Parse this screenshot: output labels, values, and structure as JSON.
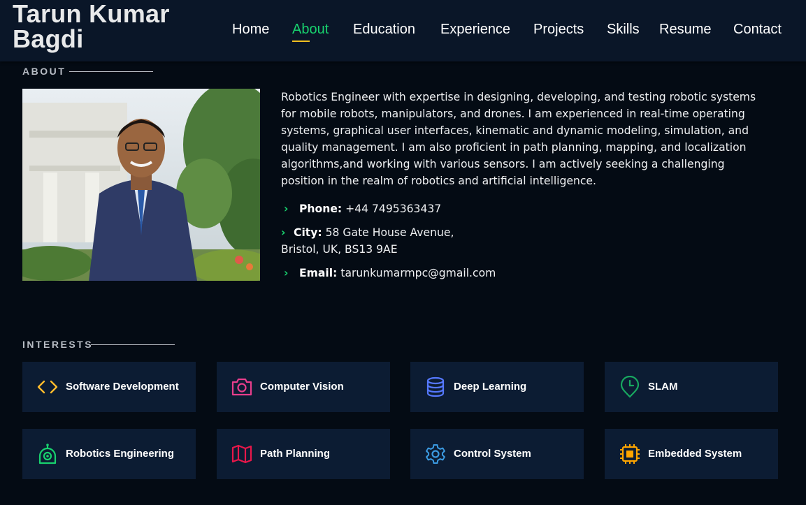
{
  "header": {
    "brand": "Tarun Kumar Bagdi",
    "nav": [
      "Home",
      "About",
      "Education",
      "Experience",
      "Projects",
      "Skills",
      "Resume",
      "Contact"
    ],
    "active": "About"
  },
  "about": {
    "section_title": "ABOUT",
    "paragraph": "Robotics Engineer with expertise in designing, developing, and testing robotic systems for mobile robots, manipulators, and drones. I am experienced in real-time operating systems, graphical user interfaces, kinematic and dynamic modeling, simulation, and quality management. I am also proficient in path planning, mapping, and localization algorithms,and working with various sensors. I am actively seeking a challenging position in the realm of robotics and artificial intelligence.",
    "phone_label": "Phone:",
    "phone_value": "+44 7495363437",
    "city_label": "City:",
    "city_value_1": "58 Gate House Avenue,",
    "city_value_2": "Bristol, UK, BS13 9AE",
    "email_label": "Email:",
    "email_value": "tarunkumarmpc@gmail.com"
  },
  "interests": {
    "section_title": "INTERESTS",
    "items": [
      {
        "label": "Software Development",
        "icon": "code-icon",
        "color": "#ffbb2c"
      },
      {
        "label": "Computer Vision",
        "icon": "camera-icon",
        "color": "#e83e8c"
      },
      {
        "label": "Deep Learning",
        "icon": "database-icon",
        "color": "#5578ff"
      },
      {
        "label": "SLAM",
        "icon": "clock-pin-icon",
        "color": "#11dbcf"
      },
      {
        "label": "Robotics Engineering",
        "icon": "robot-icon",
        "color": "#18d26e"
      },
      {
        "label": "Path Planning",
        "icon": "map-icon",
        "color": "#e80368"
      },
      {
        "label": "Control System",
        "icon": "gear-icon",
        "color": "#3b9ae1"
      },
      {
        "label": "Embedded System",
        "icon": "chip-icon",
        "color": "#ffa500"
      }
    ]
  },
  "colors": {
    "accent": "#18d26e",
    "background": "#040b14",
    "card": "#0c1c33"
  }
}
